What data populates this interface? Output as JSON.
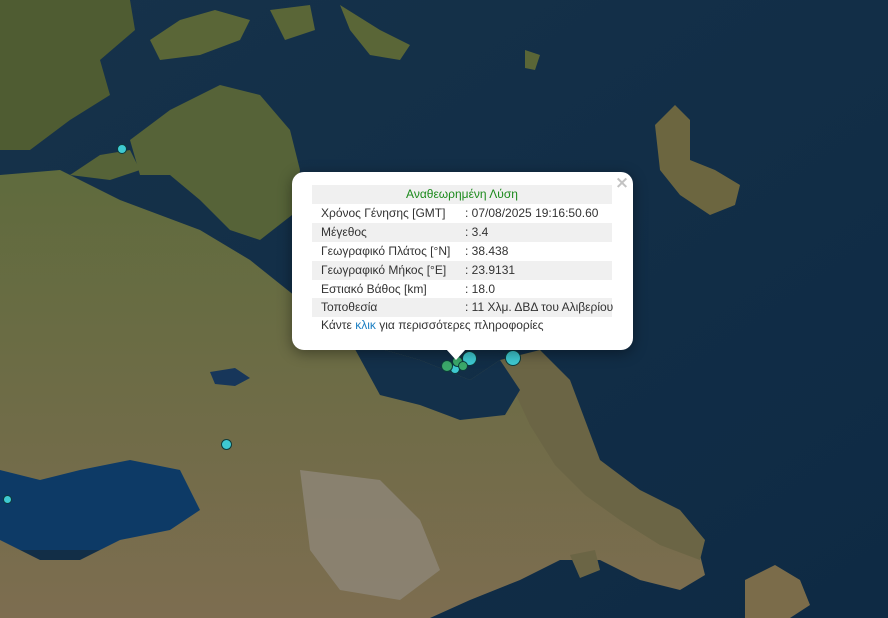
{
  "map": {
    "background": "satellite"
  },
  "markers": [
    {
      "color": "#3ec9d1"
    },
    {
      "color": "#3ec9d1"
    },
    {
      "color": "#3ec9d1"
    },
    {
      "color": "#3ec9d1"
    },
    {
      "color": "#3ec9d1"
    },
    {
      "color": "#3ec9d1"
    },
    {
      "color": "#3ba86a"
    },
    {
      "color": "#3ba86a"
    },
    {
      "color": "#3ba86a"
    }
  ],
  "popup": {
    "title": "Αναθεωρημένη Λύση",
    "rows": [
      {
        "label": "Χρόνος Γένησης [GMT]",
        "value": "07/08/2025 19:16:50.60"
      },
      {
        "label": "Μέγεθος",
        "value": "3.4"
      },
      {
        "label": "Γεωγραφικό Πλάτος [°N]",
        "value": "38.438"
      },
      {
        "label": "Γεωγραφικό Μήκος [°E]",
        "value": "23.9131"
      },
      {
        "label": "Εστιακό Βάθος [km]",
        "value": "18.0"
      },
      {
        "label": "Τοποθεσία",
        "value": "11 Χλμ. ΔΒΔ του Αλιβερίου"
      }
    ],
    "more_prefix": "Κάντε",
    "more_link": "κλικ",
    "more_suffix": "για περισσότερες πληροφορίες",
    "close_label": "×"
  },
  "colors": {
    "title_green": "#1c8a1c",
    "link_blue": "#1b7ec2"
  }
}
